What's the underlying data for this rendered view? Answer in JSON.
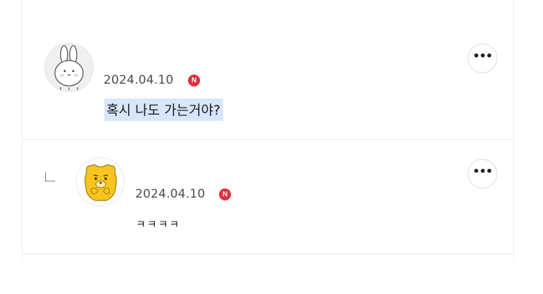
{
  "comments": [
    {
      "avatar_icon": "rabbit-avatar-icon",
      "date": "2024.04.10",
      "badge": "N",
      "text": "혹시 나도 가는거야?",
      "more_icon": "more-options-icon",
      "more_label": "•••"
    },
    {
      "is_reply": true,
      "reply_icon": "reply-indicator-icon",
      "avatar_icon": "yellow-character-avatar-icon",
      "date": "2024.04.10",
      "badge": "N",
      "text": "ㅋㅋㅋㅋ",
      "more_icon": "more-options-icon",
      "more_label": "•••"
    }
  ],
  "colors": {
    "new_badge": "#e0303c",
    "highlight": "#d7e6fa",
    "divider": "#ececec"
  }
}
